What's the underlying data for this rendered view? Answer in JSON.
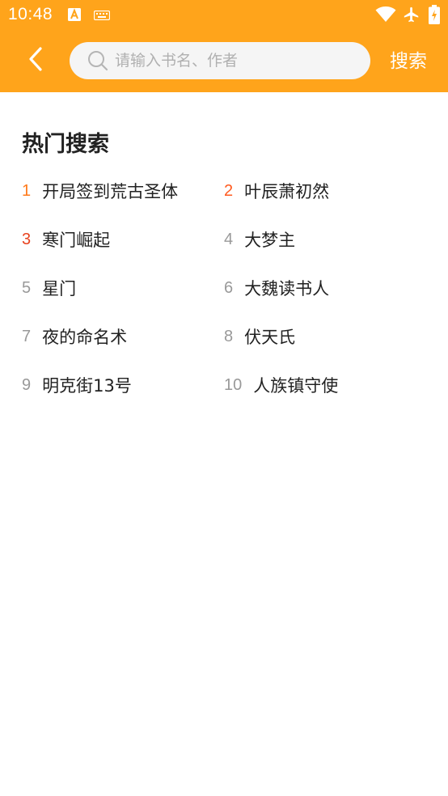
{
  "status_bar": {
    "time": "10:48",
    "icons": [
      "accessibility-a-icon",
      "keyboard-icon",
      "wifi-icon",
      "airplane-icon",
      "battery-icon"
    ]
  },
  "header": {
    "back_icon": "chevron-left-icon",
    "search_placeholder": "请输入书名、作者",
    "search_value": "",
    "search_button": "搜索"
  },
  "hot": {
    "title": "热门搜索",
    "items": [
      {
        "rank": "1",
        "name": "开局签到荒古圣体",
        "color": "#FF7A1A"
      },
      {
        "rank": "2",
        "name": "叶辰萧初然",
        "color": "#FF5A1F"
      },
      {
        "rank": "3",
        "name": "寒门崛起",
        "color": "#E8431F"
      },
      {
        "rank": "4",
        "name": "大梦主",
        "color": "#999999"
      },
      {
        "rank": "5",
        "name": "星门",
        "color": "#999999"
      },
      {
        "rank": "6",
        "name": "大魏读书人",
        "color": "#999999"
      },
      {
        "rank": "7",
        "name": "夜的命名术",
        "color": "#999999"
      },
      {
        "rank": "8",
        "name": "伏天氏",
        "color": "#999999"
      },
      {
        "rank": "9",
        "name": "明克街13号",
        "color": "#999999"
      },
      {
        "rank": "10",
        "name": "人族镇守使",
        "color": "#999999"
      }
    ]
  },
  "colors": {
    "header_bg": "#FFA41B",
    "search_bg": "#F5F5F5",
    "text_primary": "#222222",
    "rank_default": "#999999"
  }
}
